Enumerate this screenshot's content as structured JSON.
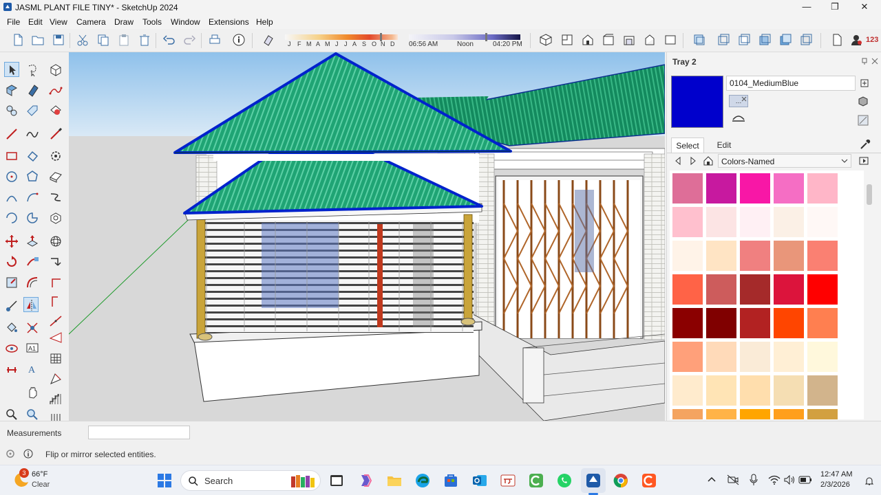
{
  "window": {
    "title": "JASML PLANT FILE TINY* - SketchUp 2024",
    "minimize": "—",
    "restore": "❐",
    "close": "✕"
  },
  "menu": [
    "File",
    "Edit",
    "View",
    "Camera",
    "Draw",
    "Tools",
    "Window",
    "Extensions",
    "Help"
  ],
  "shadow": {
    "months": [
      "J",
      "F",
      "M",
      "A",
      "M",
      "J",
      "J",
      "A",
      "S",
      "O",
      "N",
      "D"
    ],
    "time_start": "06:56 AM",
    "time_mid": "Noon",
    "time_end": "04:20 PM",
    "date_slider_level": 0.86,
    "time_slider_level": 0.7
  },
  "toolbar": {
    "overflow_label": "123"
  },
  "tray": {
    "title": "Tray 2",
    "material_name": "0104_MediumBlue",
    "material_color": "#0000CC",
    "tab_select": "Select",
    "tab_edit": "Edit",
    "library": "Colors-Named",
    "swatches": [
      "#DE6E98",
      "#C7199F",
      "#F817A6",
      "#F56EC4",
      "#FFB6C8",
      "#FFC0CE",
      "#FCE4E4",
      "#FFF0F4",
      "#FBF0E6",
      "#FFF8F6",
      "#FFF3E8",
      "#FFE4C4",
      "#F08080",
      "#E9967A",
      "#FA8072",
      "#FF6347",
      "#CD5C5C",
      "#A52A2A",
      "#DC143C",
      "#FF0000",
      "#8B0000",
      "#800000",
      "#B22222",
      "#FF4500",
      "#FF7F50",
      "#FFA07A",
      "#FFDAB9",
      "#FAEBD7",
      "#FFEFD5",
      "#FFF8DC",
      "#FFEBCD",
      "#FFE4B5",
      "#FFDEAD",
      "#F5DEB3",
      "#D2B48C",
      "#F4A460",
      "#FFB347",
      "#FFA500",
      "#FF9F1C",
      "#D2A040"
    ]
  },
  "status": {
    "measurements_label": "Measurements",
    "measurements_value": "",
    "hint": "Flip or mirror selected entities."
  },
  "taskbar": {
    "weather_temp": "66°F",
    "weather_cond": "Clear",
    "weather_badge": "3",
    "search_placeholder": "Search",
    "time": "12:47 AM",
    "date": "2/3/2026"
  }
}
